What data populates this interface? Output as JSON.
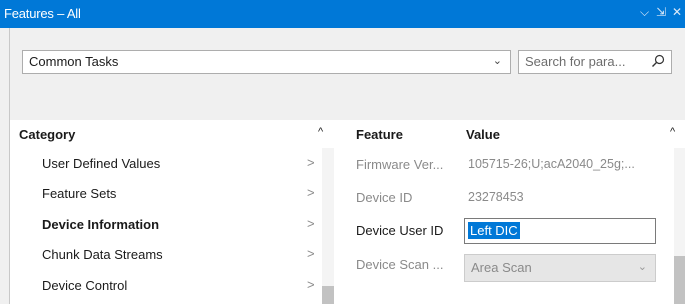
{
  "window": {
    "title": "Features – All",
    "controls": {
      "menu": "⌵",
      "pin": "⇲",
      "close": "✕"
    }
  },
  "toolbar": {
    "view_select": "Common Tasks",
    "search_placeholder": "Search for para..."
  },
  "category_panel": {
    "header": "Category",
    "items": [
      {
        "label": "User Defined Values",
        "bold": false
      },
      {
        "label": "Feature Sets",
        "bold": false
      },
      {
        "label": "Device Information",
        "bold": true
      },
      {
        "label": "Chunk Data Streams",
        "bold": false
      },
      {
        "label": "Device Control",
        "bold": false
      }
    ]
  },
  "feature_panel": {
    "headers": {
      "feature": "Feature",
      "value": "Value"
    },
    "rows": [
      {
        "feature": "Firmware Ver...",
        "value": "105715-26;U;acA2040_25g;...",
        "state": "readonly"
      },
      {
        "feature": "Device ID",
        "value": "23278453",
        "state": "readonly"
      },
      {
        "feature": "Device User ID",
        "value": "Left DIC",
        "state": "editing"
      },
      {
        "feature": "Device Scan ...",
        "value": "Area Scan",
        "state": "disabled-dropdown"
      }
    ]
  },
  "colors": {
    "titlebar": "#0078d7",
    "selection": "#0078d7",
    "panel_bg": "#ffffff",
    "chrome_bg": "#f0f0f0"
  },
  "icons": {
    "search": "search-icon",
    "dropdown": "chevron-down-icon",
    "collapse": "chevron-up-icon",
    "expand": "chevron-right-icon"
  }
}
